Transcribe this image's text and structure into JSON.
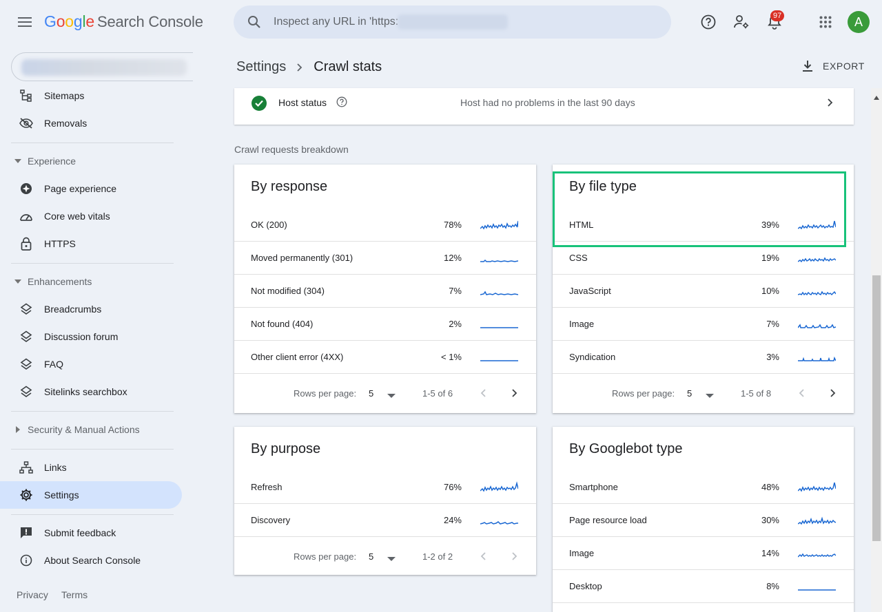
{
  "header": {
    "logo": {
      "g1": "G",
      "g2": "o",
      "g3": "o",
      "g4": "g",
      "g5": "l",
      "g6": "e",
      "product": "Search Console"
    },
    "search_placeholder": "Inspect any URL in 'https:",
    "notifications_count": "97",
    "avatar_letter": "A"
  },
  "sidebar": {
    "items_top": [
      {
        "label": "Sitemaps",
        "icon": "sitemap-icon"
      },
      {
        "label": "Removals",
        "icon": "eye-off-icon"
      }
    ],
    "experience": {
      "label": "Experience",
      "items": [
        {
          "label": "Page experience",
          "icon": "page-experience-icon"
        },
        {
          "label": "Core web vitals",
          "icon": "speedometer-icon"
        },
        {
          "label": "HTTPS",
          "icon": "lock-icon"
        }
      ]
    },
    "enhancements": {
      "label": "Enhancements",
      "items": [
        {
          "label": "Breadcrumbs",
          "icon": "layers-icon"
        },
        {
          "label": "Discussion forum",
          "icon": "layers-icon"
        },
        {
          "label": "FAQ",
          "icon": "layers-icon"
        },
        {
          "label": "Sitelinks searchbox",
          "icon": "layers-icon"
        }
      ]
    },
    "security": {
      "label": "Security & Manual Actions"
    },
    "links": {
      "label": "Links"
    },
    "settings": {
      "label": "Settings"
    },
    "feedback": {
      "label": "Submit feedback"
    },
    "about": {
      "label": "About Search Console"
    },
    "footer": {
      "privacy": "Privacy",
      "terms": "Terms"
    }
  },
  "main": {
    "breadcrumb": {
      "parent": "Settings",
      "current": "Crawl stats"
    },
    "export_label": "EXPORT",
    "host_status": {
      "label": "Host status",
      "message": "Host had no problems in the last 90 days",
      "status_color": "#188038"
    },
    "breakdown_title": "Crawl requests breakdown",
    "rows_per_page_label": "Rows per page:",
    "cards": {
      "response": {
        "title": "By response",
        "rows": [
          {
            "name": "OK (200)",
            "pct": "78%"
          },
          {
            "name": "Moved permanently (301)",
            "pct": "12%"
          },
          {
            "name": "Not modified (304)",
            "pct": "7%"
          },
          {
            "name": "Not found (404)",
            "pct": "2%"
          },
          {
            "name": "Other client error (4XX)",
            "pct": "< 1%"
          }
        ],
        "rows_per_page": "5",
        "range": "1-5 of 6"
      },
      "filetype": {
        "title": "By file type",
        "rows": [
          {
            "name": "HTML",
            "pct": "39%"
          },
          {
            "name": "CSS",
            "pct": "19%"
          },
          {
            "name": "JavaScript",
            "pct": "10%"
          },
          {
            "name": "Image",
            "pct": "7%"
          },
          {
            "name": "Syndication",
            "pct": "3%"
          }
        ],
        "rows_per_page": "5",
        "range": "1-5 of 8"
      },
      "purpose": {
        "title": "By purpose",
        "rows": [
          {
            "name": "Refresh",
            "pct": "76%"
          },
          {
            "name": "Discovery",
            "pct": "24%"
          }
        ],
        "rows_per_page": "5",
        "range": "1-2 of 2"
      },
      "googlebot": {
        "title": "By Googlebot type",
        "rows": [
          {
            "name": "Smartphone",
            "pct": "48%"
          },
          {
            "name": "Page resource load",
            "pct": "30%"
          },
          {
            "name": "Image",
            "pct": "14%"
          },
          {
            "name": "Desktop",
            "pct": "8%"
          }
        ]
      }
    }
  },
  "colors": {
    "accent": "#1a73e8",
    "sparkline": "#1967d2",
    "highlight": "#18c27a",
    "active_nav": "#d3e3fd"
  }
}
